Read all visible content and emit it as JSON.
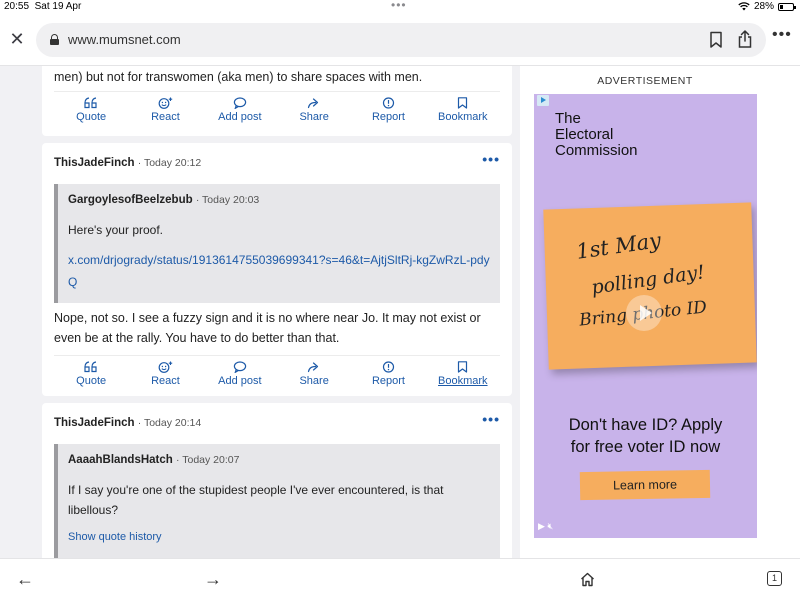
{
  "status_bar": {
    "time": "20:55",
    "date": "Sat 19 Apr",
    "battery": "28%"
  },
  "browser": {
    "url": "www.mumsnet.com",
    "tab_count": "1"
  },
  "posts": [
    {
      "text": "men) but not for transwomen (aka men) to share spaces with men."
    },
    {
      "user": "ThisJadeFinch",
      "time": "· Today 20:12",
      "quote": {
        "user": "GargoylesofBeelzebub",
        "time": "· Today 20:03",
        "text": "Here's your proof.",
        "link": "x.com/drjogrady/status/1913614755039699341?s=46&t=AjtjSltRj-kgZwRzL-pdyQ"
      },
      "body": "Nope, not so. I see a fuzzy sign and it is no where near Jo. It may not exist or even be at the rally. You have to do better than that."
    },
    {
      "user": "ThisJadeFinch",
      "time": "· Today 20:14",
      "quote": {
        "user": "AaaahBlandsHatch",
        "time": "· Today 20:07",
        "text": "If I say you're one of the stupidest people I've ever encountered, is that libellous?",
        "history": "Show quote history"
      }
    }
  ],
  "actions": {
    "quote": "Quote",
    "react": "React",
    "add_post": "Add post",
    "share": "Share",
    "report": "Report",
    "bookmark": "Bookmark"
  },
  "ad": {
    "label": "ADVERTISEMENT",
    "brand_line1": "The",
    "brand_line2": "Electoral",
    "brand_line3": "Commission",
    "note_line1": "1st May",
    "note_line2": "polling day!",
    "note_line3": "Bring photo ID",
    "headline_line1": "Don't have ID? Apply",
    "headline_line2": "for free voter ID now",
    "cta": "Learn more"
  },
  "colors": {
    "link": "#1d5aa8",
    "ad_bg": "#c8b3ea",
    "sticky_note": "#f6ad5e"
  }
}
